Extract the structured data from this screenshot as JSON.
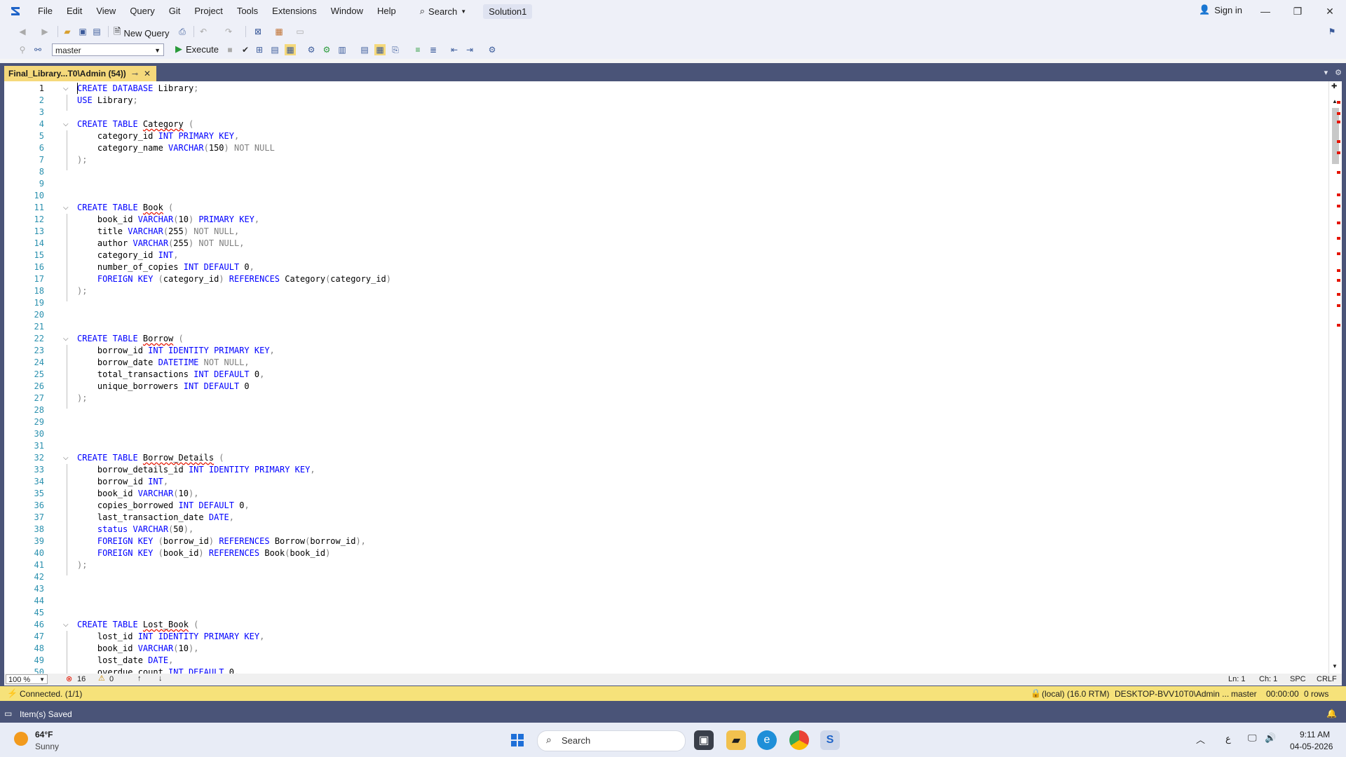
{
  "menu": [
    "File",
    "Edit",
    "View",
    "Query",
    "Git",
    "Project",
    "Tools",
    "Extensions",
    "Window",
    "Help"
  ],
  "search_label": "Search",
  "solution_name": "Solution1",
  "signin_label": "Sign in",
  "toolbar": {
    "new_query": "New Query",
    "database": "master",
    "execute": "Execute"
  },
  "tab": {
    "title": "Final_Library...T0\\Admin (54))"
  },
  "lines": [
    [
      [
        "kw",
        "CREATE DATABASE "
      ],
      [
        "t",
        "Library"
      ],
      [
        "gr",
        ";"
      ]
    ],
    [
      [
        "kw",
        "USE "
      ],
      [
        "t",
        "Library"
      ],
      [
        "gr",
        ";"
      ]
    ],
    [],
    [
      [
        "kw",
        "CREATE TABLE "
      ],
      [
        "sq",
        "Category"
      ],
      [
        "gr",
        " ("
      ]
    ],
    [
      [
        "t",
        "    category_id "
      ],
      [
        "kw",
        "INT PRIMARY KEY"
      ],
      [
        "gr",
        ","
      ]
    ],
    [
      [
        "t",
        "    category_name "
      ],
      [
        "kw",
        "VARCHAR"
      ],
      [
        "gr",
        "("
      ],
      [
        "t",
        "150"
      ],
      [
        "gr",
        ") NOT NULL"
      ]
    ],
    [
      [
        "gr",
        ");"
      ]
    ],
    [],
    [],
    [],
    [
      [
        "kw",
        "CREATE TABLE "
      ],
      [
        "sq",
        "Book"
      ],
      [
        "gr",
        " ("
      ]
    ],
    [
      [
        "t",
        "    book_id "
      ],
      [
        "kw",
        "VARCHAR"
      ],
      [
        "gr",
        "("
      ],
      [
        "t",
        "10"
      ],
      [
        "gr",
        ") "
      ],
      [
        "kw",
        "PRIMARY KEY"
      ],
      [
        "gr",
        ","
      ]
    ],
    [
      [
        "t",
        "    title "
      ],
      [
        "kw",
        "VARCHAR"
      ],
      [
        "gr",
        "("
      ],
      [
        "t",
        "255"
      ],
      [
        "gr",
        ") NOT NULL,"
      ]
    ],
    [
      [
        "t",
        "    author "
      ],
      [
        "kw",
        "VARCHAR"
      ],
      [
        "gr",
        "("
      ],
      [
        "t",
        "255"
      ],
      [
        "gr",
        ") NOT NULL,"
      ]
    ],
    [
      [
        "t",
        "    category_id "
      ],
      [
        "kw",
        "INT"
      ],
      [
        "gr",
        ","
      ]
    ],
    [
      [
        "t",
        "    number_of_copies "
      ],
      [
        "kw",
        "INT DEFAULT "
      ],
      [
        "t",
        "0"
      ],
      [
        "gr",
        ","
      ]
    ],
    [
      [
        "t",
        "    "
      ],
      [
        "kw",
        "FOREIGN KEY "
      ],
      [
        "gr",
        "("
      ],
      [
        "t",
        "category_id"
      ],
      [
        "gr",
        ") "
      ],
      [
        "kw",
        "REFERENCES "
      ],
      [
        "t",
        "Category"
      ],
      [
        "gr",
        "("
      ],
      [
        "t",
        "category_id"
      ],
      [
        "gr",
        ")"
      ]
    ],
    [
      [
        "gr",
        ");"
      ]
    ],
    [],
    [],
    [],
    [
      [
        "kw",
        "CREATE TABLE "
      ],
      [
        "sq",
        "Borrow"
      ],
      [
        "gr",
        " ("
      ]
    ],
    [
      [
        "t",
        "    borrow_id "
      ],
      [
        "kw",
        "INT IDENTITY PRIMARY KEY"
      ],
      [
        "gr",
        ","
      ]
    ],
    [
      [
        "t",
        "    borrow_date "
      ],
      [
        "kw",
        "DATETIME "
      ],
      [
        "gr",
        "NOT NULL,"
      ]
    ],
    [
      [
        "t",
        "    total_transactions "
      ],
      [
        "kw",
        "INT DEFAULT "
      ],
      [
        "t",
        "0"
      ],
      [
        "gr",
        ","
      ]
    ],
    [
      [
        "t",
        "    unique_borrowers "
      ],
      [
        "kw",
        "INT DEFAULT "
      ],
      [
        "t",
        "0"
      ]
    ],
    [
      [
        "gr",
        ");"
      ]
    ],
    [],
    [],
    [],
    [],
    [
      [
        "kw",
        "CREATE TABLE "
      ],
      [
        "sq",
        "Borrow_Details"
      ],
      [
        "gr",
        " ("
      ]
    ],
    [
      [
        "t",
        "    borrow_details_id "
      ],
      [
        "kw",
        "INT IDENTITY PRIMARY KEY"
      ],
      [
        "gr",
        ","
      ]
    ],
    [
      [
        "t",
        "    borrow_id "
      ],
      [
        "kw",
        "INT"
      ],
      [
        "gr",
        ","
      ]
    ],
    [
      [
        "t",
        "    book_id "
      ],
      [
        "kw",
        "VARCHAR"
      ],
      [
        "gr",
        "("
      ],
      [
        "t",
        "10"
      ],
      [
        "gr",
        "),"
      ]
    ],
    [
      [
        "t",
        "    copies_borrowed "
      ],
      [
        "kw",
        "INT DEFAULT "
      ],
      [
        "t",
        "0"
      ],
      [
        "gr",
        ","
      ]
    ],
    [
      [
        "t",
        "    last_transaction_date "
      ],
      [
        "kw",
        "DATE"
      ],
      [
        "gr",
        ","
      ]
    ],
    [
      [
        "t",
        "    "
      ],
      [
        "kw",
        "status VARCHAR"
      ],
      [
        "gr",
        "("
      ],
      [
        "t",
        "50"
      ],
      [
        "gr",
        "),"
      ]
    ],
    [
      [
        "t",
        "    "
      ],
      [
        "kw",
        "FOREIGN KEY "
      ],
      [
        "gr",
        "("
      ],
      [
        "t",
        "borrow_id"
      ],
      [
        "gr",
        ") "
      ],
      [
        "kw",
        "REFERENCES "
      ],
      [
        "t",
        "Borrow"
      ],
      [
        "gr",
        "("
      ],
      [
        "t",
        "borrow_id"
      ],
      [
        "gr",
        "),"
      ]
    ],
    [
      [
        "t",
        "    "
      ],
      [
        "kw",
        "FOREIGN KEY "
      ],
      [
        "gr",
        "("
      ],
      [
        "t",
        "book_id"
      ],
      [
        "gr",
        ") "
      ],
      [
        "kw",
        "REFERENCES "
      ],
      [
        "t",
        "Book"
      ],
      [
        "gr",
        "("
      ],
      [
        "t",
        "book_id"
      ],
      [
        "gr",
        ")"
      ]
    ],
    [
      [
        "gr",
        ");"
      ]
    ],
    [],
    [],
    [],
    [],
    [
      [
        "kw",
        "CREATE TABLE "
      ],
      [
        "sq",
        "Lost_Book"
      ],
      [
        "gr",
        " ("
      ]
    ],
    [
      [
        "t",
        "    lost_id "
      ],
      [
        "kw",
        "INT IDENTITY PRIMARY KEY"
      ],
      [
        "gr",
        ","
      ]
    ],
    [
      [
        "t",
        "    book_id "
      ],
      [
        "kw",
        "VARCHAR"
      ],
      [
        "gr",
        "("
      ],
      [
        "t",
        "10"
      ],
      [
        "gr",
        "),"
      ]
    ],
    [
      [
        "t",
        "    lost_date "
      ],
      [
        "kw",
        "DATE"
      ],
      [
        "gr",
        ","
      ]
    ],
    [
      [
        "t",
        "    overdue_count "
      ],
      [
        "kw",
        "INT DEFAULT "
      ],
      [
        "t",
        "0"
      ],
      [
        "gr",
        ","
      ]
    ]
  ],
  "status_row": {
    "zoom": "100 %",
    "errors": "16",
    "warnings": "0",
    "ln": "Ln: 1",
    "ch": "Ch: 1",
    "spc": "SPC",
    "crlf": "CRLF"
  },
  "connection": {
    "status": "Connected. (1/1)",
    "server": "(local) (16.0 RTM)",
    "login": "DESKTOP-BVV10T0\\Admin ...",
    "db": "master",
    "time": "00:00:00",
    "rows": "0 rows"
  },
  "main_status": "Item(s) Saved",
  "taskbar": {
    "temp": "64°F",
    "weather": "Sunny",
    "search": "Search",
    "time": "9:11 AM",
    "date": "04-05-2026",
    "lang": "ع"
  },
  "colors": {
    "accent": "#4a5478",
    "tab_active": "#f5d97b",
    "conn_bar": "#f6e27a",
    "keyword": "#0000ff",
    "line_number": "#2b91af"
  }
}
